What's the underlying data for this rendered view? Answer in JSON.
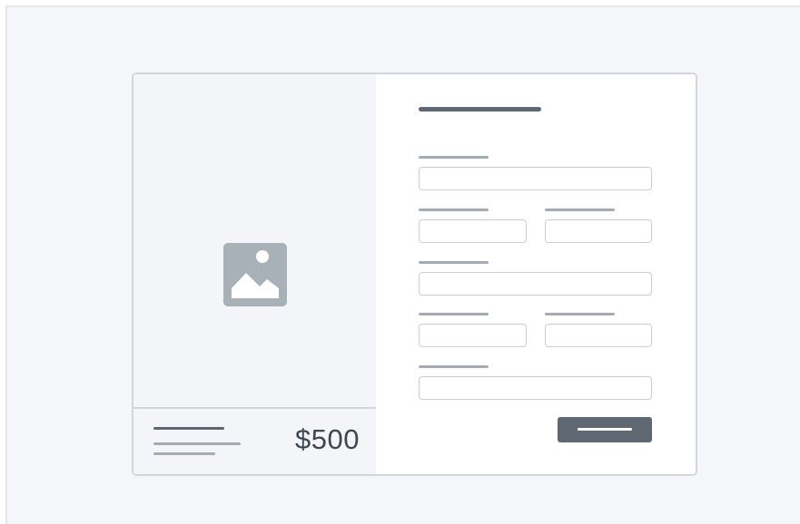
{
  "summary": {
    "price": "$500"
  },
  "colors": {
    "page_bg": "#f5f6fa",
    "card_border": "#d3d6db",
    "placeholder_dark": "#5f6872",
    "placeholder_light": "#a4abb3",
    "image_placeholder": "#a8b0b8"
  },
  "icons": {
    "image_placeholder": "image-icon"
  }
}
